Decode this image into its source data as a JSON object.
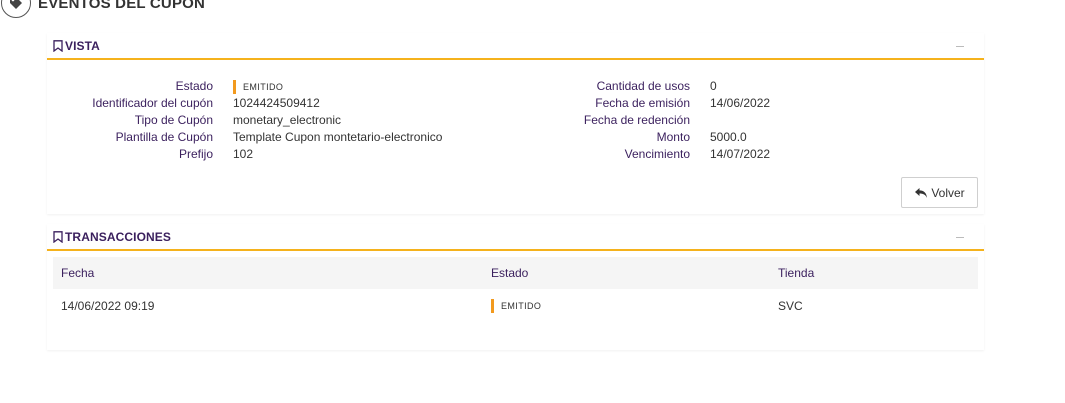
{
  "page": {
    "title": "EVENTOS DEL CUPON",
    "icon": "tag-icon"
  },
  "vista": {
    "title": "VISTA",
    "left_fields": [
      {
        "label": "Estado",
        "value": "EMITIDO",
        "type": "status"
      },
      {
        "label": "Identificador del cupón",
        "value": "1024424509412"
      },
      {
        "label": "Tipo de Cupón",
        "value": "monetary_electronic"
      },
      {
        "label": "Plantilla de Cupón",
        "value": "Template Cupon montetario-electronico"
      },
      {
        "label": "Prefijo",
        "value": "102"
      }
    ],
    "right_fields": [
      {
        "label": "Cantidad de usos",
        "value": "0"
      },
      {
        "label": "Fecha de emisión",
        "value": "14/06/2022"
      },
      {
        "label": "Fecha de redención",
        "value": ""
      },
      {
        "label": "Monto",
        "value": "5000.0"
      },
      {
        "label": "Vencimiento",
        "value": "14/07/2022"
      }
    ],
    "back_button_label": "Volver"
  },
  "transacciones": {
    "title": "TRANSACCIONES",
    "columns": [
      "Fecha",
      "Estado",
      "Tienda"
    ],
    "rows": [
      {
        "fecha": "14/06/2022 09:19",
        "estado": "EMITIDO",
        "tienda": "SVC"
      }
    ]
  },
  "colors": {
    "accent": "#f5b21c",
    "status_bar": "#f29a1e",
    "label": "#3a1f5d",
    "header_row_bg": "#f5f5f5"
  }
}
